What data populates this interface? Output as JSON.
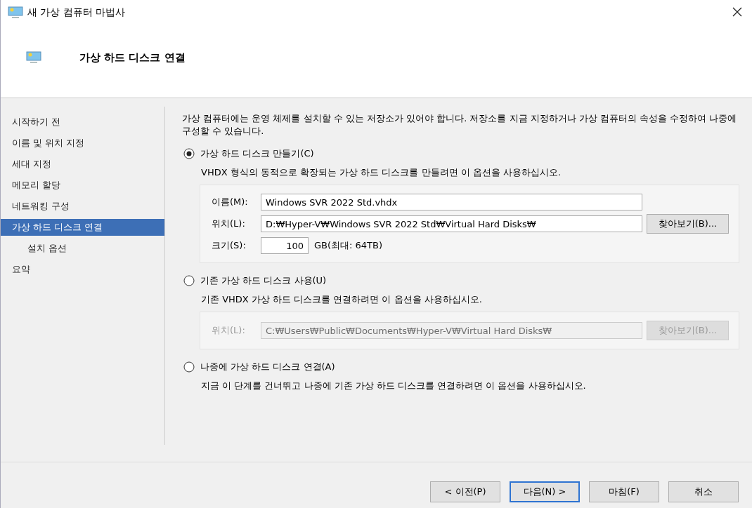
{
  "window": {
    "title": "새 가상 컴퓨터 마법사"
  },
  "header": {
    "title": "가상 하드 디스크 연결"
  },
  "sidebar": {
    "items": [
      {
        "label": "시작하기 전",
        "selected": false
      },
      {
        "label": "이름 및 위치 지정",
        "selected": false
      },
      {
        "label": "세대 지정",
        "selected": false
      },
      {
        "label": "메모리 할당",
        "selected": false
      },
      {
        "label": "네트워킹 구성",
        "selected": false
      },
      {
        "label": "가상 하드 디스크 연결",
        "selected": true,
        "children": [
          {
            "label": "설치 옵션",
            "selected": false
          }
        ]
      },
      {
        "label": "요약",
        "selected": false
      }
    ]
  },
  "intro": "가상 컴퓨터에는 운영 체제를 설치할 수 있는 저장소가 있어야 합니다. 저장소를 지금 지정하거나 가상 컴퓨터의 속성을 수정하여 나중에 구성할 수 있습니다.",
  "options": [
    {
      "label": "가상 하드 디스크 만들기(C)",
      "selected": true,
      "description": "VHDX 형식의 동적으로 확장되는 가상 하드 디스크를 만들려면 이 옵션을 사용하십시오.",
      "disabled": false,
      "fields": [
        {
          "kind": "text",
          "label": "이름(M):",
          "value": "Windows SVR 2022 Std.vhdx"
        },
        {
          "kind": "browse",
          "label": "위치(L):",
          "value": "D:₩Hyper-V₩Windows SVR 2022 Std₩Virtual Hard Disks₩",
          "button": "찾아보기(B)..."
        },
        {
          "kind": "size",
          "label": "크기(S):",
          "value": "100",
          "unit": "GB(최대: 64TB)"
        }
      ]
    },
    {
      "label": "기존 가상 하드 디스크 사용(U)",
      "selected": false,
      "description": "기존 VHDX 가상 하드 디스크를 연결하려면 이 옵션을 사용하십시오.",
      "disabled": true,
      "fields": [
        {
          "kind": "browse",
          "label": "위치(L):",
          "value": "C:₩Users₩Public₩Documents₩Hyper-V₩Virtual Hard Disks₩",
          "button": "찾아보기(B)..."
        }
      ]
    },
    {
      "label": "나중에 가상 하드 디스크 연결(A)",
      "selected": false,
      "description": "지금 이 단계를 건너뛰고 나중에 기존 가상 하드 디스크를 연결하려면 이 옵션을 사용하십시오."
    }
  ],
  "buttons": [
    {
      "label": "< 이전(P)",
      "default": false
    },
    {
      "label": "다음(N) >",
      "default": true
    },
    {
      "label": "마침(F)",
      "default": false
    },
    {
      "label": "취소",
      "default": false
    }
  ]
}
